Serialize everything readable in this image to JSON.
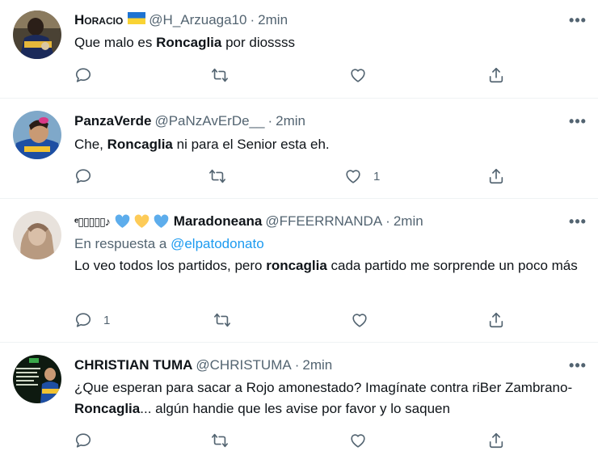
{
  "tweets": [
    {
      "display_name": "Horacio",
      "handle": "@H_Arzuaga10",
      "separator": "·",
      "time": "2min",
      "text_parts": [
        "Que malo es ",
        "Roncaglia",
        " por diossss"
      ],
      "reply_count": "",
      "like_count": ""
    },
    {
      "display_name": "PanzaVerde",
      "handle": "@PaNzAvErDe__",
      "separator": "·",
      "time": "2min",
      "text_parts": [
        "Che, ",
        "Roncaglia",
        " ni para el Senior esta eh."
      ],
      "reply_count": "",
      "like_count": "1"
    },
    {
      "display_name_prefix": "ᵉ▯▯▯▯▯♪",
      "display_name": "Maradoneana",
      "handle": "@FFEERRNANDA",
      "separator": "·",
      "time": "2min",
      "reply_prefix": "En respuesta a ",
      "reply_handle": "@elpatodonato",
      "text_parts": [
        "Lo veo todos los partidos, pero ",
        "roncaglia",
        " cada partido me sorprende un poco más"
      ],
      "reply_count": "1",
      "like_count": ""
    },
    {
      "display_name": "CHRISTIAN TUMA",
      "handle": "@CHRISTUMA",
      "separator": "·",
      "time": "2min",
      "text_parts": [
        "¿Que esperan para sacar a Rojo amonestado? Imagínate contra riBer Zambrano-",
        "Roncaglia",
        "... algún handie que les avise por favor y lo saquen"
      ],
      "reply_count": "",
      "like_count": ""
    }
  ],
  "more_label": "•••",
  "colors": {
    "text": "#0f1419",
    "secondary": "#536471",
    "link": "#1d9bf0",
    "divider": "#eff3f4",
    "heart_blue": "#5dadec",
    "heart_yellow": "#fdcb58"
  },
  "icons": {
    "reply": "reply-icon",
    "retweet": "retweet-icon",
    "like": "heart-icon",
    "share": "share-icon",
    "more": "more-icon",
    "flag": "ukraine-flag-icon"
  }
}
